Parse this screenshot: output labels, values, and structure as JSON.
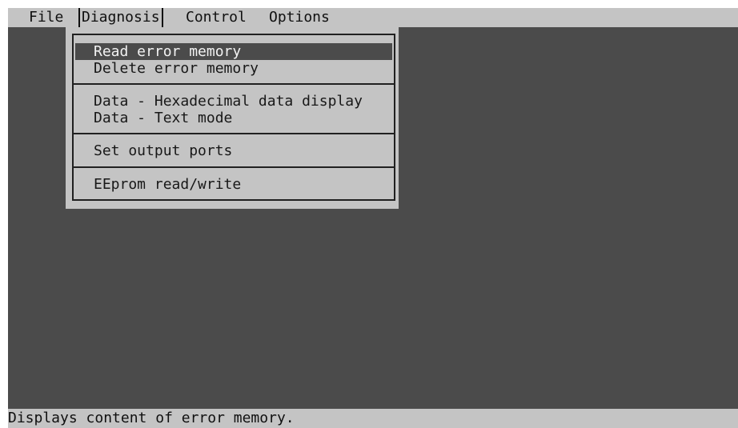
{
  "menubar": {
    "items": [
      {
        "label": "File"
      },
      {
        "label": "Diagnosis"
      },
      {
        "label": "Control"
      },
      {
        "label": "Options"
      }
    ],
    "active": "Diagnosis"
  },
  "diagnosis_menu": {
    "groups": [
      {
        "items": [
          {
            "label": "Read error memory",
            "highlighted": true
          },
          {
            "label": "Delete error memory"
          }
        ]
      },
      {
        "items": [
          {
            "label": "Data - Hexadecimal data display"
          },
          {
            "label": "Data - Text mode"
          }
        ]
      },
      {
        "items": [
          {
            "label": "Set output ports"
          }
        ]
      },
      {
        "items": [
          {
            "label": "EEprom read/write"
          }
        ]
      }
    ]
  },
  "statusbar": {
    "text": "Displays content of error memory."
  },
  "colors": {
    "background": "#4b4b4b",
    "panel": "#c4c4c4",
    "highlight": "#4b4b4b",
    "highlight_text": "#f2f2f2"
  }
}
